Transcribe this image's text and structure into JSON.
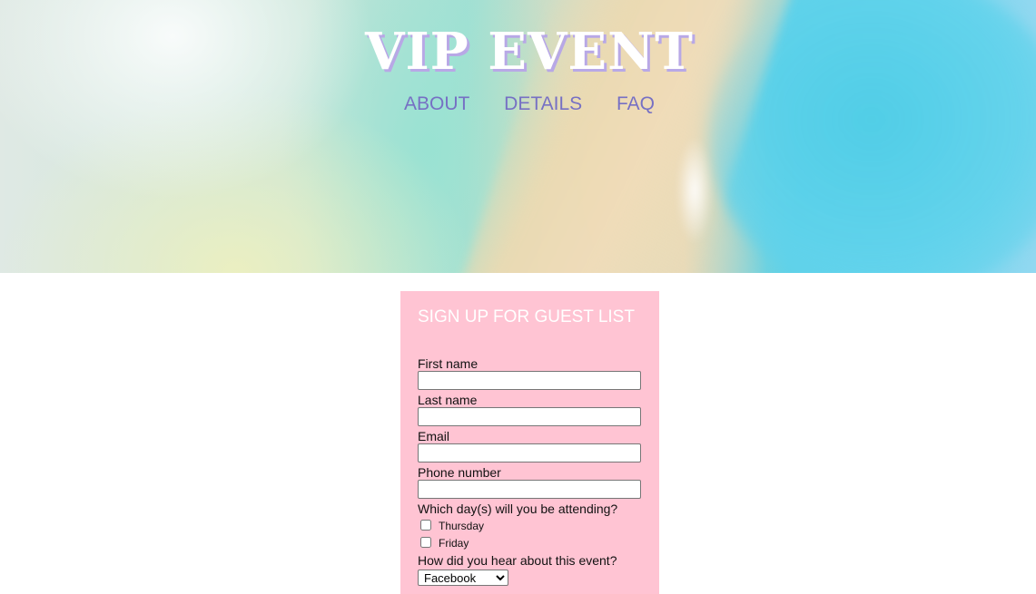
{
  "header": {
    "brand": "VIP EVENT",
    "nav": [
      "ABOUT",
      "DETAILS",
      "FAQ"
    ]
  },
  "form": {
    "title": "SIGN UP FOR GUEST LIST",
    "fields": [
      {
        "label": "First name",
        "value": ""
      },
      {
        "label": "Last name",
        "value": ""
      },
      {
        "label": "Email",
        "value": ""
      },
      {
        "label": "Phone number",
        "value": ""
      }
    ],
    "days_question": "Which day(s) will you be attending?",
    "days": [
      {
        "label": "Thursday",
        "checked": false
      },
      {
        "label": "Friday",
        "checked": false
      }
    ],
    "source_question": "How did you hear about this event?",
    "source_selected": "Facebook"
  },
  "colors": {
    "nav_link": "#7670c4",
    "form_bg": "#ffc4d3",
    "brand_shadow": "#b8a8e6"
  }
}
